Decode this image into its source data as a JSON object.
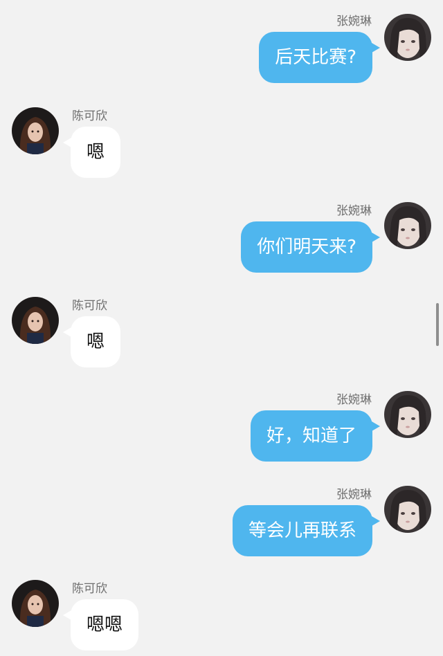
{
  "contacts": {
    "me": {
      "name": "张婉琳",
      "avatar_icon": "girl-photo-avatar-light"
    },
    "other": {
      "name": "陈可欣",
      "avatar_icon": "girl-photo-avatar-dark"
    }
  },
  "messages": [
    {
      "sender": "张婉琳",
      "text": "后天比赛?"
    },
    {
      "sender": "陈可欣",
      "text": "嗯"
    },
    {
      "sender": "张婉琳",
      "text": "你们明天来?"
    },
    {
      "sender": "陈可欣",
      "text": "嗯"
    },
    {
      "sender": "张婉琳",
      "text": "好，知道了"
    },
    {
      "sender": "张婉琳",
      "text": "等会儿再联系"
    },
    {
      "sender": "陈可欣",
      "text": "嗯嗯"
    }
  ],
  "colors": {
    "background": "#f2f2f2",
    "outgoing_bubble": "#4fb6ee",
    "incoming_bubble": "#ffffff",
    "name_text": "#6e6e6e"
  }
}
